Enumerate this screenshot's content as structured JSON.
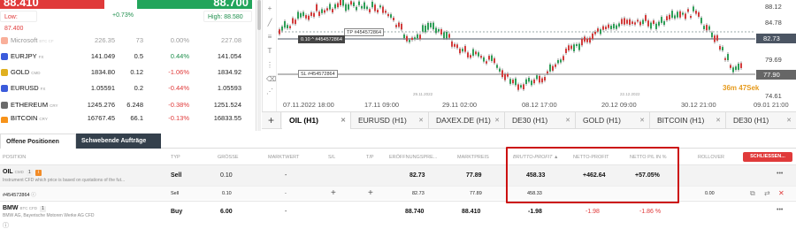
{
  "price_boxes": {
    "sell_price": "88.410",
    "buy_price": "88.700"
  },
  "top_low": "Low: 87.400",
  "top_change": "+0.73%",
  "top_high": "High: 88.580",
  "watchlist": [
    {
      "name": "Microsoft",
      "type": "BTC CF",
      "c1": "226.35",
      "c2": "73",
      "c3": "0.00%",
      "c4": "227.08",
      "icon_color": "#f25022",
      "faded": true
    },
    {
      "name": "EURJPY",
      "type": "FX",
      "c1": "141.049",
      "c2": "0.5",
      "c3": "0.44%",
      "c4": "141.054",
      "icon_color": "#3b5bdb",
      "dir": "pos"
    },
    {
      "name": "GOLD",
      "type": "CMD",
      "c1": "1834.80",
      "c2": "0.12",
      "c3": "-1.06%",
      "c4": "1834.92",
      "icon_color": "#e0b020",
      "dir": "neg"
    },
    {
      "name": "EURUSD",
      "type": "FX",
      "c1": "1.05591",
      "c2": "0.2",
      "c3": "-0.44%",
      "c4": "1.05593",
      "icon_color": "#3b5bdb",
      "dir": "neg"
    },
    {
      "name": "ETHEREUM",
      "type": "CRY",
      "c1": "1245.276",
      "c2": "6.248",
      "c3": "-0.38%",
      "c4": "1251.524",
      "icon_color": "#6b6b6b",
      "dir": "neg"
    },
    {
      "name": "BITCOIN",
      "type": "CRY",
      "c1": "16767.45",
      "c2": "66.1",
      "c3": "-0.13%",
      "c4": "16833.55",
      "icon_color": "#f7931a",
      "dir": "neg"
    }
  ],
  "chart": {
    "y_ticks": [
      "88.12",
      "84.78",
      "79.69",
      "74.61"
    ],
    "y_tag_current": "82.73",
    "y_tag_sl": "77.90",
    "x_ticks": [
      "07.11.2022 18:00",
      "17.11 09:00",
      "29.11 02:00",
      "08.12 17:00",
      "20.12 09:00",
      "30.12 21:00",
      "09.01 21:00"
    ],
    "small_dates": [
      "29.11.2022",
      "22.12.2022"
    ],
    "tp_label": "TP #454572864",
    "pos_label": "0.10 ^ #454572864",
    "sl_label": "SL #454572864",
    "countdown_min": "36m",
    "countdown_sec": "47Sek"
  },
  "chart_tabs": [
    "OIL (H1)",
    "EURUSD (H1)",
    "DAXEX.DE (H1)",
    "DE30 (H1)",
    "GOLD (H1)",
    "BITCOIN (H1)",
    "DE30 (H1)"
  ],
  "positions_tabs": {
    "open": "Offene Positionen",
    "pending": "Schwebende Aufträge"
  },
  "headers": {
    "position": "Position",
    "typ": "Typ",
    "groesse": "Grösse",
    "marktwert": "Marktwert",
    "sl": "S/L",
    "tp": "T/P",
    "eroeffnung": "Eröffnungspre...",
    "marktpreis": "Marktpreis",
    "brutto": "Brutto-Profit ▲",
    "netto": "Netto-Profit",
    "netto_pl": "Netto P/L in %",
    "rollover": "Rollover",
    "close_all": "SCHLIESSEN..."
  },
  "rows": {
    "oil": {
      "name": "OIL",
      "type": "CMD",
      "count": "1",
      "desc": "Instrument CFD which price is based on quotations of the fut...",
      "typ": "Sell",
      "size": "0.10",
      "marktwert": "-",
      "open": "82.73",
      "market": "77.89",
      "brutto": "458.33",
      "netto": "+462.64",
      "netto_pct": "+57.05%"
    },
    "oil_sub": {
      "id": "#454572864",
      "typ": "Sell",
      "size": "0.10",
      "marktwert": "-",
      "open": "82.73",
      "market": "77.89",
      "brutto": "458.33",
      "rollover": "0.00"
    },
    "bmw": {
      "name": "BMW",
      "type": "BTC CFD",
      "count": "1",
      "desc": "BMW AG, Bayerische Motoren Werke AG CFD",
      "typ": "Buy",
      "size": "6.00",
      "marktwert": "-",
      "open": "88.740",
      "market": "88.410",
      "brutto": "-1.98",
      "netto": "-1.98",
      "netto_pct": "-1.86 %"
    }
  }
}
